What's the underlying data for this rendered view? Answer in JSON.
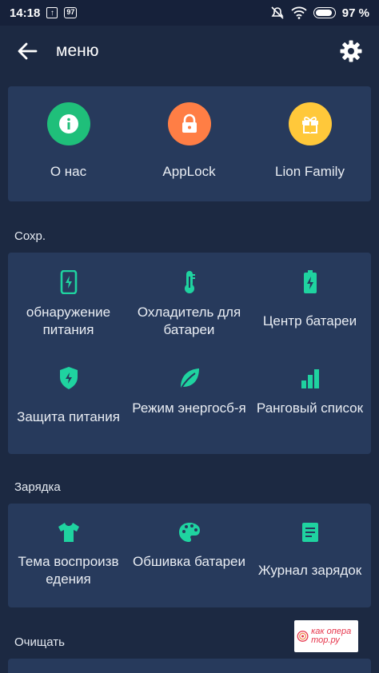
{
  "status_bar": {
    "time": "14:18",
    "notif1": "↑",
    "notif2": "97",
    "battery_text": "97 %"
  },
  "app_bar": {
    "title": "меню"
  },
  "top_card": {
    "items": [
      {
        "label": "О нас",
        "icon": "info-icon",
        "color": "#1fbf7a"
      },
      {
        "label": "AppLock",
        "icon": "lock-icon",
        "color": "#ff7e45"
      },
      {
        "label": "Lion Family",
        "icon": "gift-icon",
        "color": "#ffc83a"
      }
    ]
  },
  "sections": [
    {
      "title": "Сохр.",
      "items": [
        {
          "label": "обнаружение питания",
          "icon": "phone-charging-icon"
        },
        {
          "label": "Охладитель для батареи",
          "icon": "thermometer-icon"
        },
        {
          "label": "Центр батареи",
          "icon": "battery-icon"
        },
        {
          "label": "Защита питания",
          "icon": "shield-icon"
        },
        {
          "label": "Режим энергосб-я",
          "icon": "leaf-icon"
        },
        {
          "label": "Ранговый список",
          "icon": "bar-chart-icon"
        }
      ]
    },
    {
      "title": "Зарядка",
      "items": [
        {
          "label": "Тема воспроизв едения",
          "icon": "shirt-icon"
        },
        {
          "label": "Обшивка батареи",
          "icon": "palette-icon"
        },
        {
          "label": "Журнал зарядок",
          "icon": "log-icon"
        }
      ]
    },
    {
      "title": "Очищать"
    }
  ],
  "watermark": {
    "text": "как опера тор.ру"
  },
  "colors": {
    "accent": "#1fd3a0",
    "background": "#1c2942",
    "card": "#273a5c"
  }
}
